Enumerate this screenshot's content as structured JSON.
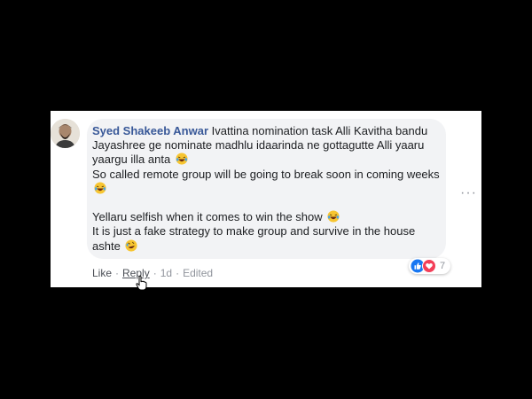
{
  "comment": {
    "author": "Syed Shakeeb Anwar",
    "line1": "Ivattina nomination task Alli Kavitha bandu",
    "line2": "Jayashree ge nominate madhlu idaarinda ne gottagutte Alli yaaru",
    "line3": "yaargu illa anta",
    "line4": "So called remote group will be going to break soon in coming weeks",
    "line5": "Yellaru selfish when it comes to win the show",
    "line6": "It is just a fake strategy to make group and survive in the house",
    "line7": "ashte",
    "emoji_icon": "laughing-emoji-icon"
  },
  "actions": {
    "like": "Like",
    "reply": "Reply",
    "time": "1d",
    "edited": "Edited"
  },
  "reactions": {
    "count": "7",
    "icons": [
      "like-icon",
      "love-icon"
    ]
  },
  "colors": {
    "author": "#385898",
    "bubble": "#f2f3f5",
    "meta": "#90949c",
    "like_blue": "#1877f2",
    "love_red": "#f33e58"
  }
}
